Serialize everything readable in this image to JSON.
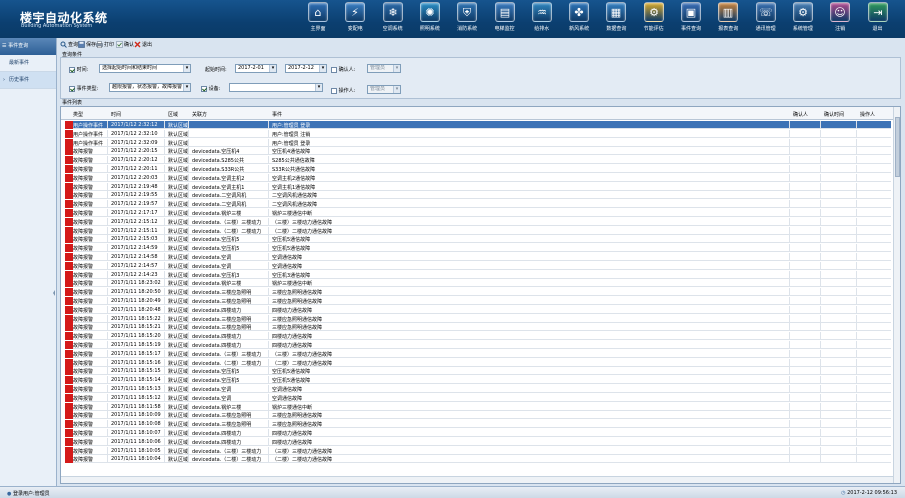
{
  "app": {
    "title": "楼宇自动化系统",
    "subtitle": "Building Automation System"
  },
  "nav": [
    {
      "label": "主界面",
      "icon": "home-icon",
      "color": "#2f6fb6"
    },
    {
      "label": "变配电",
      "icon": "power-icon",
      "color": "#3a7fc4"
    },
    {
      "label": "空调系统",
      "icon": "aircon-icon",
      "color": "#2c6aa8"
    },
    {
      "label": "照明系统",
      "icon": "light-icon",
      "color": "#2a8fc6"
    },
    {
      "label": "消防系统",
      "icon": "fire-shield-icon",
      "color": "#2f74b3"
    },
    {
      "label": "电梯监控",
      "icon": "elevator-icon",
      "color": "#3b7bbf"
    },
    {
      "label": "给排水",
      "icon": "water-icon",
      "color": "#2f86c0"
    },
    {
      "label": "新风系统",
      "icon": "fan-icon",
      "color": "#2d74b8"
    },
    {
      "label": "数据查询",
      "icon": "data-icon",
      "color": "#3580c2"
    },
    {
      "label": "节能评估",
      "icon": "energy-icon",
      "color": "#d7a92a"
    },
    {
      "label": "事件查询",
      "icon": "event-icon",
      "color": "#3a6db5"
    },
    {
      "label": "报表查询",
      "icon": "report-icon",
      "color": "#c9823a"
    },
    {
      "label": "通讯管理",
      "icon": "comm-icon",
      "color": "#3b70b0"
    },
    {
      "label": "系统管理",
      "icon": "gear-icon",
      "color": "#4a7fb4"
    },
    {
      "label": "注销",
      "icon": "logout-user-icon",
      "color": "#b04a8e"
    },
    {
      "label": "退出",
      "icon": "exit-icon",
      "color": "#2f9a5a"
    }
  ],
  "sidebar": {
    "header": "事件查询",
    "items": [
      {
        "label": "最新事件"
      },
      {
        "label": "历史事件"
      }
    ]
  },
  "toolbar": {
    "query": "查询",
    "save": "保存",
    "print": "打印",
    "confirm": "确认",
    "exit": "退出"
  },
  "query": {
    "section_title": "查询条件",
    "time_label": "时间:",
    "time_value": "选择起始时间和结束时间",
    "start_time_label": "起始时间:",
    "start_date": "2017-2-01",
    "end_date": "2017-2-12",
    "confirm_person_label": "确认人:",
    "confirm_person_value": "管理员",
    "event_type_label": "事件类型:",
    "event_type_value": "越限报警，状态报警，故障报警",
    "device_label": "设备:",
    "device_value": "",
    "operator_label": "操作人:",
    "operator_value": "管理员"
  },
  "list": {
    "section_title": "事件列表",
    "columns": [
      "类型",
      "时间",
      "区域",
      "关联方",
      "事件",
      "确认人",
      "确认时间",
      "操作人"
    ],
    "rows": [
      [
        "用户操作事件",
        "2017/1/12 2:32:12",
        "默认区域",
        "",
        "用户:管理员 登录"
      ],
      [
        "用户操作事件",
        "2017/1/12 2:32:10",
        "默认区域",
        "",
        "用户:管理员 注销"
      ],
      [
        "用户操作事件",
        "2017/1/12 2:32:09",
        "默认区域",
        "",
        "用户:管理员 登录"
      ],
      [
        "故障报警",
        "2017/1/12 2:20:15",
        "默认区域",
        "devicedata.空压机4",
        "空压机4通信故障"
      ],
      [
        "故障报警",
        "2017/1/12 2:20:12",
        "默认区域",
        "devicedata.S285公共",
        "S285公共通信故障"
      ],
      [
        "故障报警",
        "2017/1/12 2:20:11",
        "默认区域",
        "devicedata.S33R公共",
        "S33R公共通信故障"
      ],
      [
        "故障报警",
        "2017/1/12 2:20:03",
        "默认区域",
        "devicedata.空调主机2",
        "空调主机2通信故障"
      ],
      [
        "故障报警",
        "2017/1/12 2:19:48",
        "默认区域",
        "devicedata.空调主机1",
        "空调主机1通信故障"
      ],
      [
        "故障报警",
        "2017/1/12 2:19:55",
        "默认区域",
        "devicedata.二空调风机",
        "二空调风机通信故障"
      ],
      [
        "故障报警",
        "2017/1/12 2:19:57",
        "默认区域",
        "devicedata.二空调风机",
        "二空调风机通信故障"
      ],
      [
        "故障报警",
        "2017/1/12 2:17:17",
        "默认区域",
        "devicedata.锅炉三楼",
        "锅炉三楼通信中断"
      ],
      [
        "故障报警",
        "2017/1/12 2:15:12",
        "默认区域",
        "devicedata.（三楼）三楼动力",
        "（三楼）三楼动力通信故障"
      ],
      [
        "故障报警",
        "2017/1/12 2:15:11",
        "默认区域",
        "devicedata.（二楼）二楼动力",
        "（二楼）二楼动力通信故障"
      ],
      [
        "故障报警",
        "2017/1/12 2:15:03",
        "默认区域",
        "devicedata.空压机5",
        "空压机5通信故障"
      ],
      [
        "故障报警",
        "2017/1/12 2:14:59",
        "默认区域",
        "devicedata.空压机5",
        "空压机5通信故障"
      ],
      [
        "故障报警",
        "2017/1/12 2:14:58",
        "默认区域",
        "devicedata.空调",
        "空调通信故障"
      ],
      [
        "故障报警",
        "2017/1/12 2:14:57",
        "默认区域",
        "devicedata.空调",
        "空调通信故障"
      ],
      [
        "故障报警",
        "2017/1/12 2:14:23",
        "默认区域",
        "devicedata.空压机3",
        "空压机3通信故障"
      ],
      [
        "故障报警",
        "2017/1/11 18:23:02",
        "默认区域",
        "devicedata.锅炉三楼",
        "锅炉三楼通信中断"
      ],
      [
        "故障报警",
        "2017/1/11 18:20:50",
        "默认区域",
        "devicedata.三楼应急照明",
        "三楼应急照明通信故障"
      ],
      [
        "故障报警",
        "2017/1/11 18:20:49",
        "默认区域",
        "devicedata.三楼应急照明",
        "三楼应急照明通信故障"
      ],
      [
        "故障报警",
        "2017/1/11 18:20:48",
        "默认区域",
        "devicedata.四楼动力",
        "四楼动力通信故障"
      ],
      [
        "故障报警",
        "2017/1/11 18:15:22",
        "默认区域",
        "devicedata.三楼应急照明",
        "三楼应急照明通信故障"
      ],
      [
        "故障报警",
        "2017/1/11 18:15:21",
        "默认区域",
        "devicedata.三楼应急照明",
        "三楼应急照明通信故障"
      ],
      [
        "故障报警",
        "2017/1/11 18:15:20",
        "默认区域",
        "devicedata.四楼动力",
        "四楼动力通信故障"
      ],
      [
        "故障报警",
        "2017/1/11 18:15:19",
        "默认区域",
        "devicedata.四楼动力",
        "四楼动力通信故障"
      ],
      [
        "故障报警",
        "2017/1/11 18:15:17",
        "默认区域",
        "devicedata.（三楼）三楼动力",
        "（三楼）三楼动力通信故障"
      ],
      [
        "故障报警",
        "2017/1/11 18:15:16",
        "默认区域",
        "devicedata.（二楼）二楼动力",
        "（二楼）二楼动力通信故障"
      ],
      [
        "故障报警",
        "2017/1/11 18:15:15",
        "默认区域",
        "devicedata.空压机5",
        "空压机5通信故障"
      ],
      [
        "故障报警",
        "2017/1/11 18:15:14",
        "默认区域",
        "devicedata.空压机5",
        "空压机5通信故障"
      ],
      [
        "故障报警",
        "2017/1/11 18:15:13",
        "默认区域",
        "devicedata.空调",
        "空调通信故障"
      ],
      [
        "故障报警",
        "2017/1/11 18:15:12",
        "默认区域",
        "devicedata.空调",
        "空调通信故障"
      ],
      [
        "故障报警",
        "2017/1/11 18:11:58",
        "默认区域",
        "devicedata.锅炉三楼",
        "锅炉三楼通信中断"
      ],
      [
        "故障报警",
        "2017/1/11 18:10:09",
        "默认区域",
        "devicedata.三楼应急照明",
        "三楼应急照明通信故障"
      ],
      [
        "故障报警",
        "2017/1/11 18:10:08",
        "默认区域",
        "devicedata.三楼应急照明",
        "三楼应急照明通信故障"
      ],
      [
        "故障报警",
        "2017/1/11 18:10:07",
        "默认区域",
        "devicedata.四楼动力",
        "四楼动力通信故障"
      ],
      [
        "故障报警",
        "2017/1/11 18:10:06",
        "默认区域",
        "devicedata.四楼动力",
        "四楼动力通信故障"
      ],
      [
        "故障报警",
        "2017/1/11 18:10:05",
        "默认区域",
        "devicedata.（三楼）三楼动力",
        "（三楼）三楼动力通信故障"
      ],
      [
        "故障报警",
        "2017/1/11 18:10:04",
        "默认区域",
        "devicedata.（二楼）二楼动力",
        "（二楼）二楼动力通信故障"
      ]
    ]
  },
  "status": {
    "user": "登录用户:管理员",
    "time": "2017-2-12 09:56:13"
  }
}
